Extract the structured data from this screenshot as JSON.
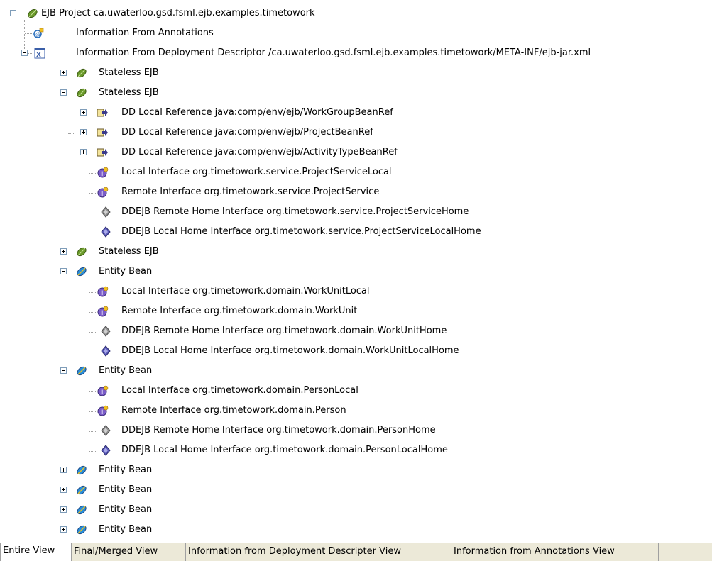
{
  "tree": {
    "nodes": [
      {
        "label": "EJB Project ca.uwaterloo.gsd.fsml.ejb.examples.timetowork",
        "icon": "ejb-project-icon"
      },
      {
        "label": "Information From Annotations",
        "icon": "annotations-icon"
      },
      {
        "label": "Information From Deployment Descriptor /ca.uwaterloo.gsd.fsml.ejb.examples.timetowork/META-INF/ejb-jar.xml",
        "icon": "xml-descriptor-icon"
      },
      {
        "label": "Stateless EJB",
        "icon": "stateless-ejb-icon"
      },
      {
        "label": "Stateless EJB",
        "icon": "stateless-ejb-icon"
      },
      {
        "label": "DD Local Reference java:comp/env/ejb/WorkGroupBeanRef",
        "icon": "reference-icon"
      },
      {
        "label": "DD Local Reference java:comp/env/ejb/ProjectBeanRef",
        "icon": "reference-icon"
      },
      {
        "label": "DD Local Reference java:comp/env/ejb/ActivityTypeBeanRef",
        "icon": "reference-icon"
      },
      {
        "label": "Local Interface org.timetowork.service.ProjectServiceLocal",
        "icon": "interface-icon"
      },
      {
        "label": "Remote Interface org.timetowork.service.ProjectService",
        "icon": "interface-icon"
      },
      {
        "label": "DDEJB Remote Home Interface org.timetowork.service.ProjectServiceHome",
        "icon": "remote-home-icon"
      },
      {
        "label": "DDEJB Local Home Interface org.timetowork.service.ProjectServiceLocalHome",
        "icon": "local-home-icon"
      },
      {
        "label": "Stateless EJB",
        "icon": "stateless-ejb-icon"
      },
      {
        "label": "Entity Bean",
        "icon": "entity-bean-icon"
      },
      {
        "label": "Local Interface org.timetowork.domain.WorkUnitLocal",
        "icon": "interface-icon"
      },
      {
        "label": "Remote Interface org.timetowork.domain.WorkUnit",
        "icon": "interface-icon"
      },
      {
        "label": "DDEJB Remote Home Interface org.timetowork.domain.WorkUnitHome",
        "icon": "remote-home-icon"
      },
      {
        "label": "DDEJB Local Home Interface org.timetowork.domain.WorkUnitLocalHome",
        "icon": "local-home-icon"
      },
      {
        "label": "Entity Bean",
        "icon": "entity-bean-icon"
      },
      {
        "label": "Local Interface org.timetowork.domain.PersonLocal",
        "icon": "interface-icon"
      },
      {
        "label": "Remote Interface org.timetowork.domain.Person",
        "icon": "interface-icon"
      },
      {
        "label": "DDEJB Remote Home Interface org.timetowork.domain.PersonHome",
        "icon": "remote-home-icon"
      },
      {
        "label": "DDEJB Local Home Interface org.timetowork.domain.PersonLocalHome",
        "icon": "local-home-icon"
      },
      {
        "label": "Entity Bean",
        "icon": "entity-bean-icon"
      },
      {
        "label": "Entity Bean",
        "icon": "entity-bean-icon"
      },
      {
        "label": "Entity Bean",
        "icon": "entity-bean-icon"
      },
      {
        "label": "Entity Bean",
        "icon": "entity-bean-icon"
      }
    ]
  },
  "tabs": [
    {
      "label": "Entire View",
      "active": true
    },
    {
      "label": "Final/Merged View",
      "active": false
    },
    {
      "label": "Information from Deployment Descripter View",
      "active": false
    },
    {
      "label": "Information from Annotations View",
      "active": false
    }
  ]
}
